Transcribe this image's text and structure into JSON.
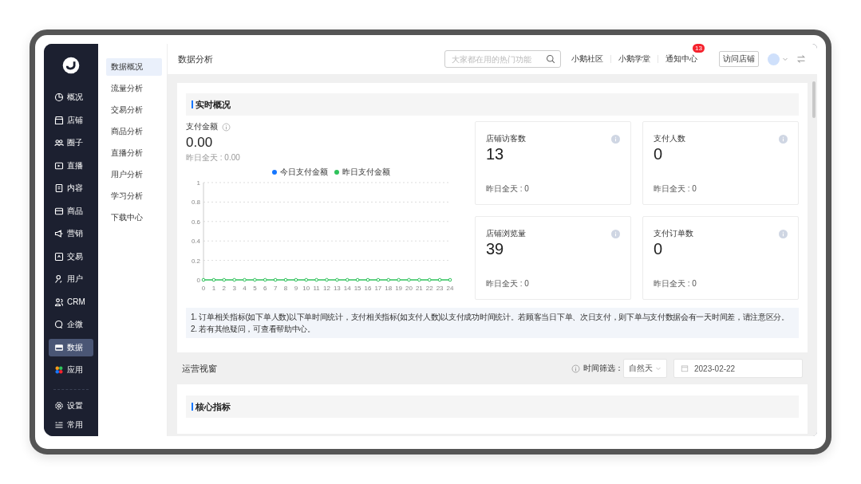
{
  "sidebar": {
    "items": [
      {
        "label": "概况",
        "selected": false
      },
      {
        "label": "店铺",
        "selected": false
      },
      {
        "label": "圈子",
        "selected": false
      },
      {
        "label": "直播",
        "selected": false
      },
      {
        "label": "内容",
        "selected": false
      },
      {
        "label": "商品",
        "selected": false
      },
      {
        "label": "营销",
        "selected": false
      },
      {
        "label": "交易",
        "selected": false
      },
      {
        "label": "用户",
        "selected": false
      },
      {
        "label": "CRM",
        "selected": false
      },
      {
        "label": "企微",
        "selected": false
      },
      {
        "label": "数据",
        "selected": true
      },
      {
        "label": "应用",
        "selected": false
      }
    ],
    "bottom_items": [
      {
        "label": "设置"
      },
      {
        "label": "常用"
      }
    ]
  },
  "submenu": {
    "items": [
      {
        "label": "数据概况",
        "selected": true
      },
      {
        "label": "流量分析",
        "selected": false
      },
      {
        "label": "交易分析",
        "selected": false
      },
      {
        "label": "商品分析",
        "selected": false
      },
      {
        "label": "直播分析",
        "selected": false
      },
      {
        "label": "用户分析",
        "selected": false
      },
      {
        "label": "学习分析",
        "selected": false
      },
      {
        "label": "下载中心",
        "selected": false
      }
    ]
  },
  "header": {
    "title": "数据分析",
    "search": {
      "placeholder": "大家都在用的热门功能"
    },
    "links": [
      "小鹅社区",
      "小鹅学堂",
      "通知中心"
    ],
    "notification_badge": "13",
    "visit_button": "访问店铺"
  },
  "realtime": {
    "title": "实时概况",
    "payment": {
      "label": "支付金额",
      "value": "0.00",
      "yesterday": "昨日全天 : 0.00"
    },
    "chart": {
      "chart_data": {
        "type": "line",
        "x": [
          0,
          1,
          2,
          3,
          4,
          5,
          6,
          7,
          8,
          9,
          10,
          11,
          12,
          13,
          14,
          15,
          16,
          17,
          18,
          19,
          20,
          21,
          22,
          23,
          24
        ],
        "series": [
          {
            "name": "今日支付金额",
            "color": "#1677ff",
            "values": [
              null,
              null,
              null,
              null,
              null,
              null,
              null,
              null,
              null,
              null,
              null,
              null,
              null,
              null,
              null,
              null,
              null,
              null,
              null,
              null,
              null,
              null,
              null,
              null,
              null
            ]
          },
          {
            "name": "昨日支付金额",
            "color": "#2fc25b",
            "marker": "circle",
            "values": [
              0,
              0,
              0,
              0,
              0,
              0,
              0,
              0,
              0,
              0,
              0,
              0,
              0,
              0,
              0,
              0,
              0,
              0,
              0,
              0,
              0,
              0,
              0,
              0,
              0
            ]
          }
        ],
        "xlim": [
          0,
          24
        ],
        "ylim": [
          0,
          1
        ],
        "grid": true,
        "legend": true,
        "yticks": [
          0,
          0.2,
          0.4,
          0.6,
          0.8,
          1
        ],
        "xticks": [
          0,
          1,
          2,
          3,
          4,
          5,
          6,
          7,
          8,
          9,
          10,
          11,
          12,
          13,
          14,
          15,
          16,
          17,
          18,
          19,
          20,
          21,
          22,
          23,
          24
        ]
      }
    },
    "cards": [
      {
        "label": "店铺访客数",
        "value": "13",
        "yesterday": "昨日全天 : 0"
      },
      {
        "label": "支付人数",
        "value": "0",
        "yesterday": "昨日全天 : 0"
      },
      {
        "label": "店铺浏览量",
        "value": "39",
        "yesterday": "昨日全天 : 0"
      },
      {
        "label": "支付订单数",
        "value": "0",
        "yesterday": "昨日全天 : 0"
      }
    ],
    "notes": [
      "1. 订单相关指标(如下单人数)以下单时间统计，支付相关指标(如支付人数)以支付成功时间统计。若顾客当日下单、次日支付，则下单与支付数据会有一天时间差，请注意区分。",
      "2. 若有其他疑问，可查看帮助中心。"
    ]
  },
  "operations": {
    "title": "运营视窗",
    "filter_label": "时间筛选：",
    "period_select": "自然天",
    "date": "2023-02-22"
  },
  "core": {
    "title": "核心指标"
  }
}
